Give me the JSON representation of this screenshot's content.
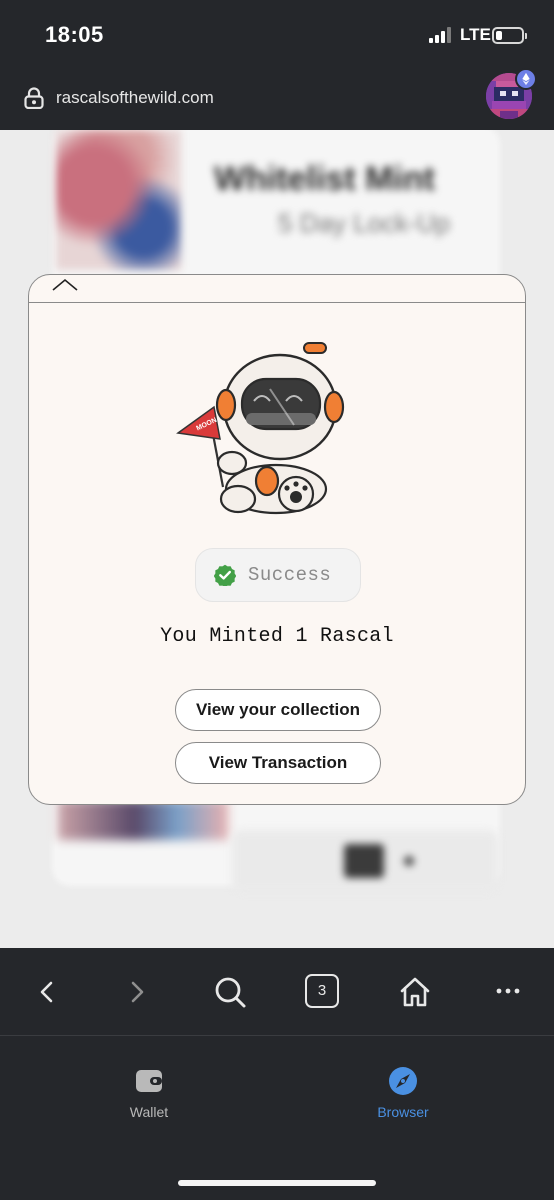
{
  "status_bar": {
    "time": "18:05",
    "network": "LTE"
  },
  "url_bar": {
    "url": "rascalsofthewild.com",
    "lock_icon": "lock-icon",
    "account_icon": "pixel-avatar",
    "badge_icon": "ethereum-icon"
  },
  "background_page": {
    "title": "Whitelist Mint",
    "subtitle": "5 Day Lock-Up"
  },
  "modal": {
    "collapse_icon": "chevron-up-icon",
    "mascot": {
      "flag_text": "MOON"
    },
    "status": {
      "icon": "check-circle-icon",
      "label": "Success",
      "color": "#43a047"
    },
    "result": "You Minted 1 Rascal",
    "buttons": {
      "collection": "View your collection",
      "transaction": "View Transaction"
    }
  },
  "browser_toolbar": {
    "back_icon": "chevron-left-icon",
    "forward_icon": "chevron-right-icon",
    "search_icon": "search-icon",
    "tab_count": "3",
    "home_icon": "home-icon",
    "more_icon": "more-horizontal-icon"
  },
  "bottom_nav": {
    "items": [
      {
        "label": "Wallet",
        "icon": "wallet-icon",
        "active": false
      },
      {
        "label": "Browser",
        "icon": "compass-icon",
        "active": true
      }
    ],
    "active_color": "#4a90e2"
  }
}
